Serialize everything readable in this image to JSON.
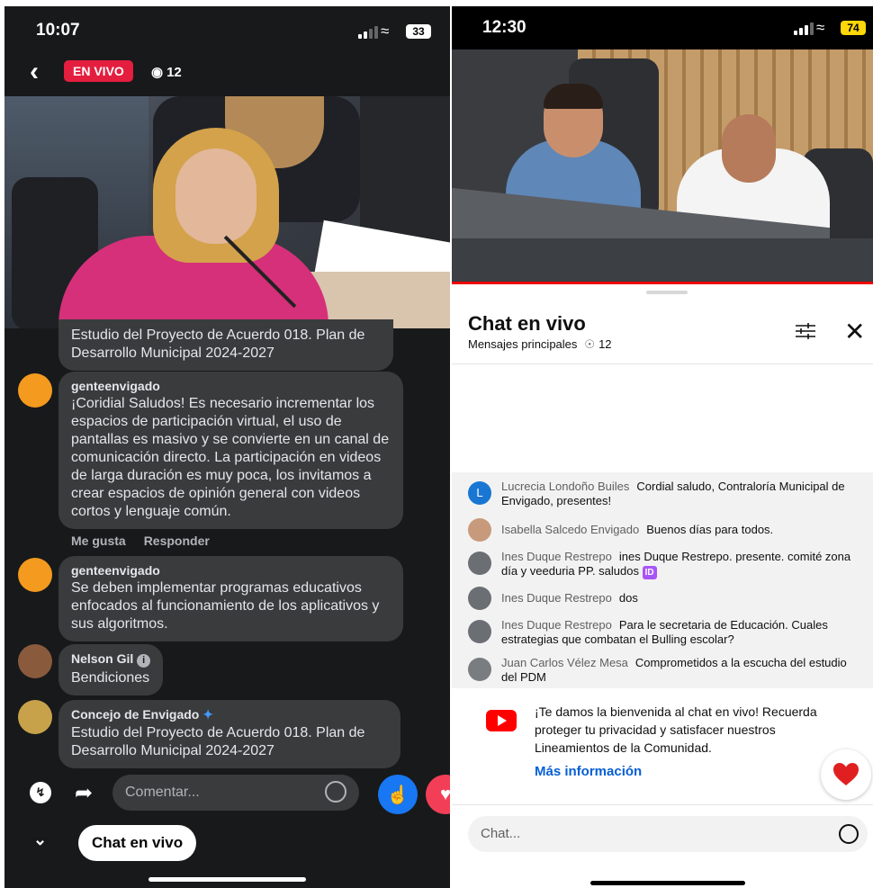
{
  "left": {
    "status": {
      "time": "10:07",
      "battery": "33"
    },
    "header": {
      "live_label": "EN VIVO",
      "viewer_count": "12"
    },
    "comments": [
      {
        "name": "",
        "text": "Estudio del Proyecto de Acuerdo 018. Plan de Desarrollo Municipal 2024-2027"
      },
      {
        "name": "genteenvigado",
        "text": "¡Coridial Saludos! Es necesario incrementar los espacios de participación virtual, el uso de pantallas es masivo y se convierte en un canal de comunicación directo. La participación en videos de larga duración es muy poca, los invitamos a crear espacios de opinión general con videos cortos y lenguaje común."
      },
      {
        "name": "genteenvigado",
        "text": "Se deben implementar programas educativos enfocados al funcionamiento de los aplicativos y sus algoritmos."
      },
      {
        "name": "Nelson Gil",
        "text": "Bendiciones"
      },
      {
        "name": "Concejo de Envigado",
        "text": "Estudio del Proyecto de Acuerdo 018. Plan de Desarrollo Municipal 2024-2027"
      }
    ],
    "actions": {
      "like": "Me gusta",
      "reply": "Responder"
    },
    "composer": {
      "placeholder": "Comentar..."
    },
    "chat_button": "Chat en vivo"
  },
  "right": {
    "status": {
      "time": "12:30",
      "battery": "74"
    },
    "chat": {
      "title": "Chat en vivo",
      "subtitle": "Mensajes principales",
      "viewer_count": "12"
    },
    "messages": [
      {
        "author": "Lucrecia Londoño Builes",
        "text": "Cordial saludo, Contraloría Municipal de Envigado, presentes!",
        "avatar_letter": "L"
      },
      {
        "author": "Isabella Salcedo Envigado",
        "text": "Buenos días para todos."
      },
      {
        "author": "Ines Duque Restrepo",
        "text": "ines Duque Restrepo. presente. comité zona día y veeduria PP. saludos",
        "badge": "ID"
      },
      {
        "author": "Ines Duque Restrepo",
        "text": "dos"
      },
      {
        "author": "Ines Duque Restrepo",
        "text": "Para le secretaria de Educación. Cuales estrategias que combatan el Bulling escolar?"
      },
      {
        "author": "Juan Carlos Vélez Mesa",
        "text": "Comprometidos a la escucha del estudio del PDM"
      }
    ],
    "welcome": {
      "text": "¡Te damos la bienvenida al chat en vivo! Recuerda proteger tu privacidad y satisfacer nuestros Lineamientos de la Comunidad.",
      "link": "Más información"
    },
    "input": {
      "placeholder": "Chat..."
    }
  },
  "colors": {
    "live_red": "#e41e3f",
    "fb_blue": "#1877f2",
    "yt_red": "#ff0000",
    "yt_link": "#065fd4"
  }
}
